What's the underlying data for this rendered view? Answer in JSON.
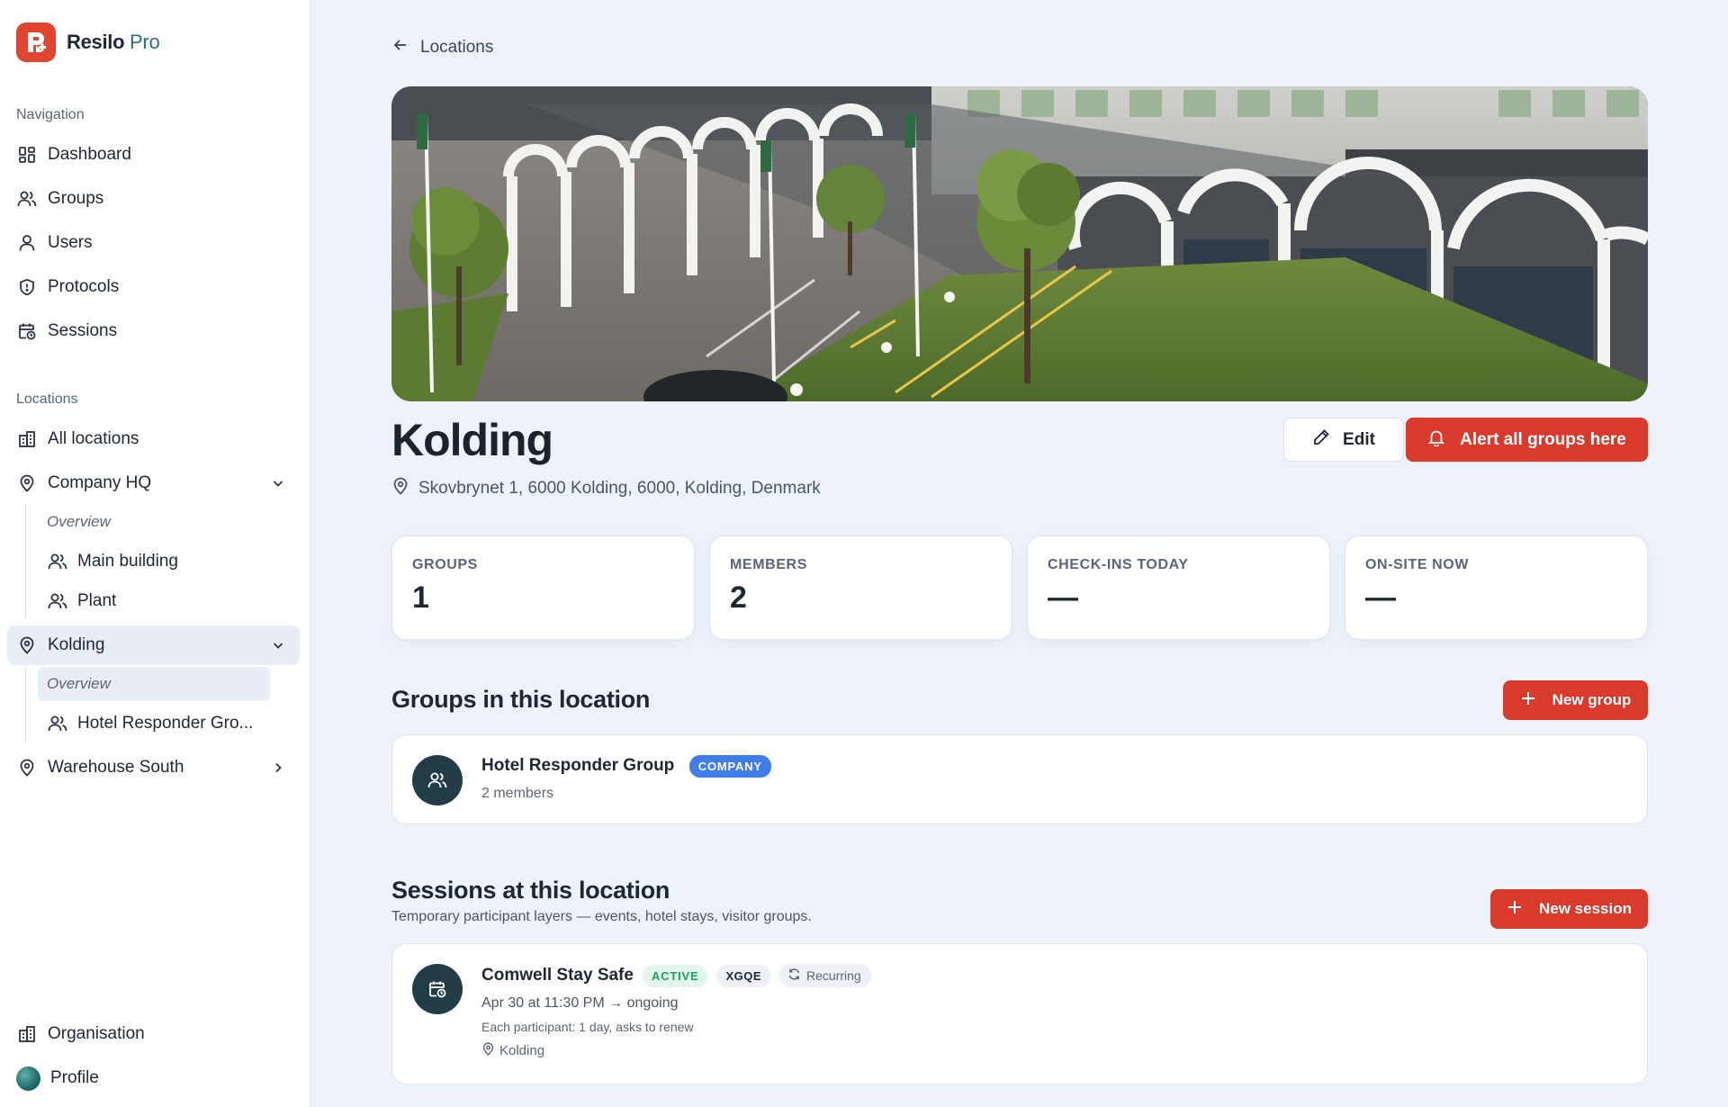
{
  "brand": {
    "name": "Resilo",
    "suffix": "Pro"
  },
  "sidebar": {
    "nav_heading": "Navigation",
    "nav": [
      {
        "label": "Dashboard",
        "icon": "grid-icon"
      },
      {
        "label": "Groups",
        "icon": "users-icon"
      },
      {
        "label": "Users",
        "icon": "user-icon"
      },
      {
        "label": "Protocols",
        "icon": "shield-icon"
      },
      {
        "label": "Sessions",
        "icon": "calendar-clock-icon"
      }
    ],
    "locations_heading": "Locations",
    "all_locations": "All locations",
    "company_hq": {
      "label": "Company HQ",
      "overview": "Overview",
      "children": [
        "Main building",
        "Plant"
      ]
    },
    "kolding": {
      "label": "Kolding",
      "overview": "Overview",
      "children": [
        "Hotel Responder Gro..."
      ]
    },
    "warehouse_south": "Warehouse South",
    "organisation": "Organisation",
    "profile": "Profile"
  },
  "main": {
    "back_label": "Locations",
    "title": "Kolding",
    "address": "Skovbrynet 1, 6000 Kolding, 6000, Kolding, Denmark",
    "edit_label": "Edit",
    "alert_label": "Alert all groups here",
    "stats": [
      {
        "label": "GROUPS",
        "value": "1"
      },
      {
        "label": "MEMBERS",
        "value": "2"
      },
      {
        "label": "CHECK-INS TODAY",
        "value": "—"
      },
      {
        "label": "ON-SITE NOW",
        "value": "—"
      }
    ],
    "groups_heading": "Groups in this location",
    "new_group_label": "New group",
    "group": {
      "name": "Hotel Responder Group",
      "badge": "COMPANY",
      "members": "2 members"
    },
    "sessions_heading": "Sessions at this location",
    "sessions_sub": "Temporary participant layers — events, hotel stays, visitor groups.",
    "new_session_label": "New session",
    "session": {
      "name": "Comwell Stay Safe",
      "status": "ACTIVE",
      "code": "XGQE",
      "recurring": "Recurring",
      "time": "Apr 30 at 11:30 PM → ongoing",
      "rule": "Each participant: 1 day, asks to renew",
      "location": "Kolding"
    }
  }
}
